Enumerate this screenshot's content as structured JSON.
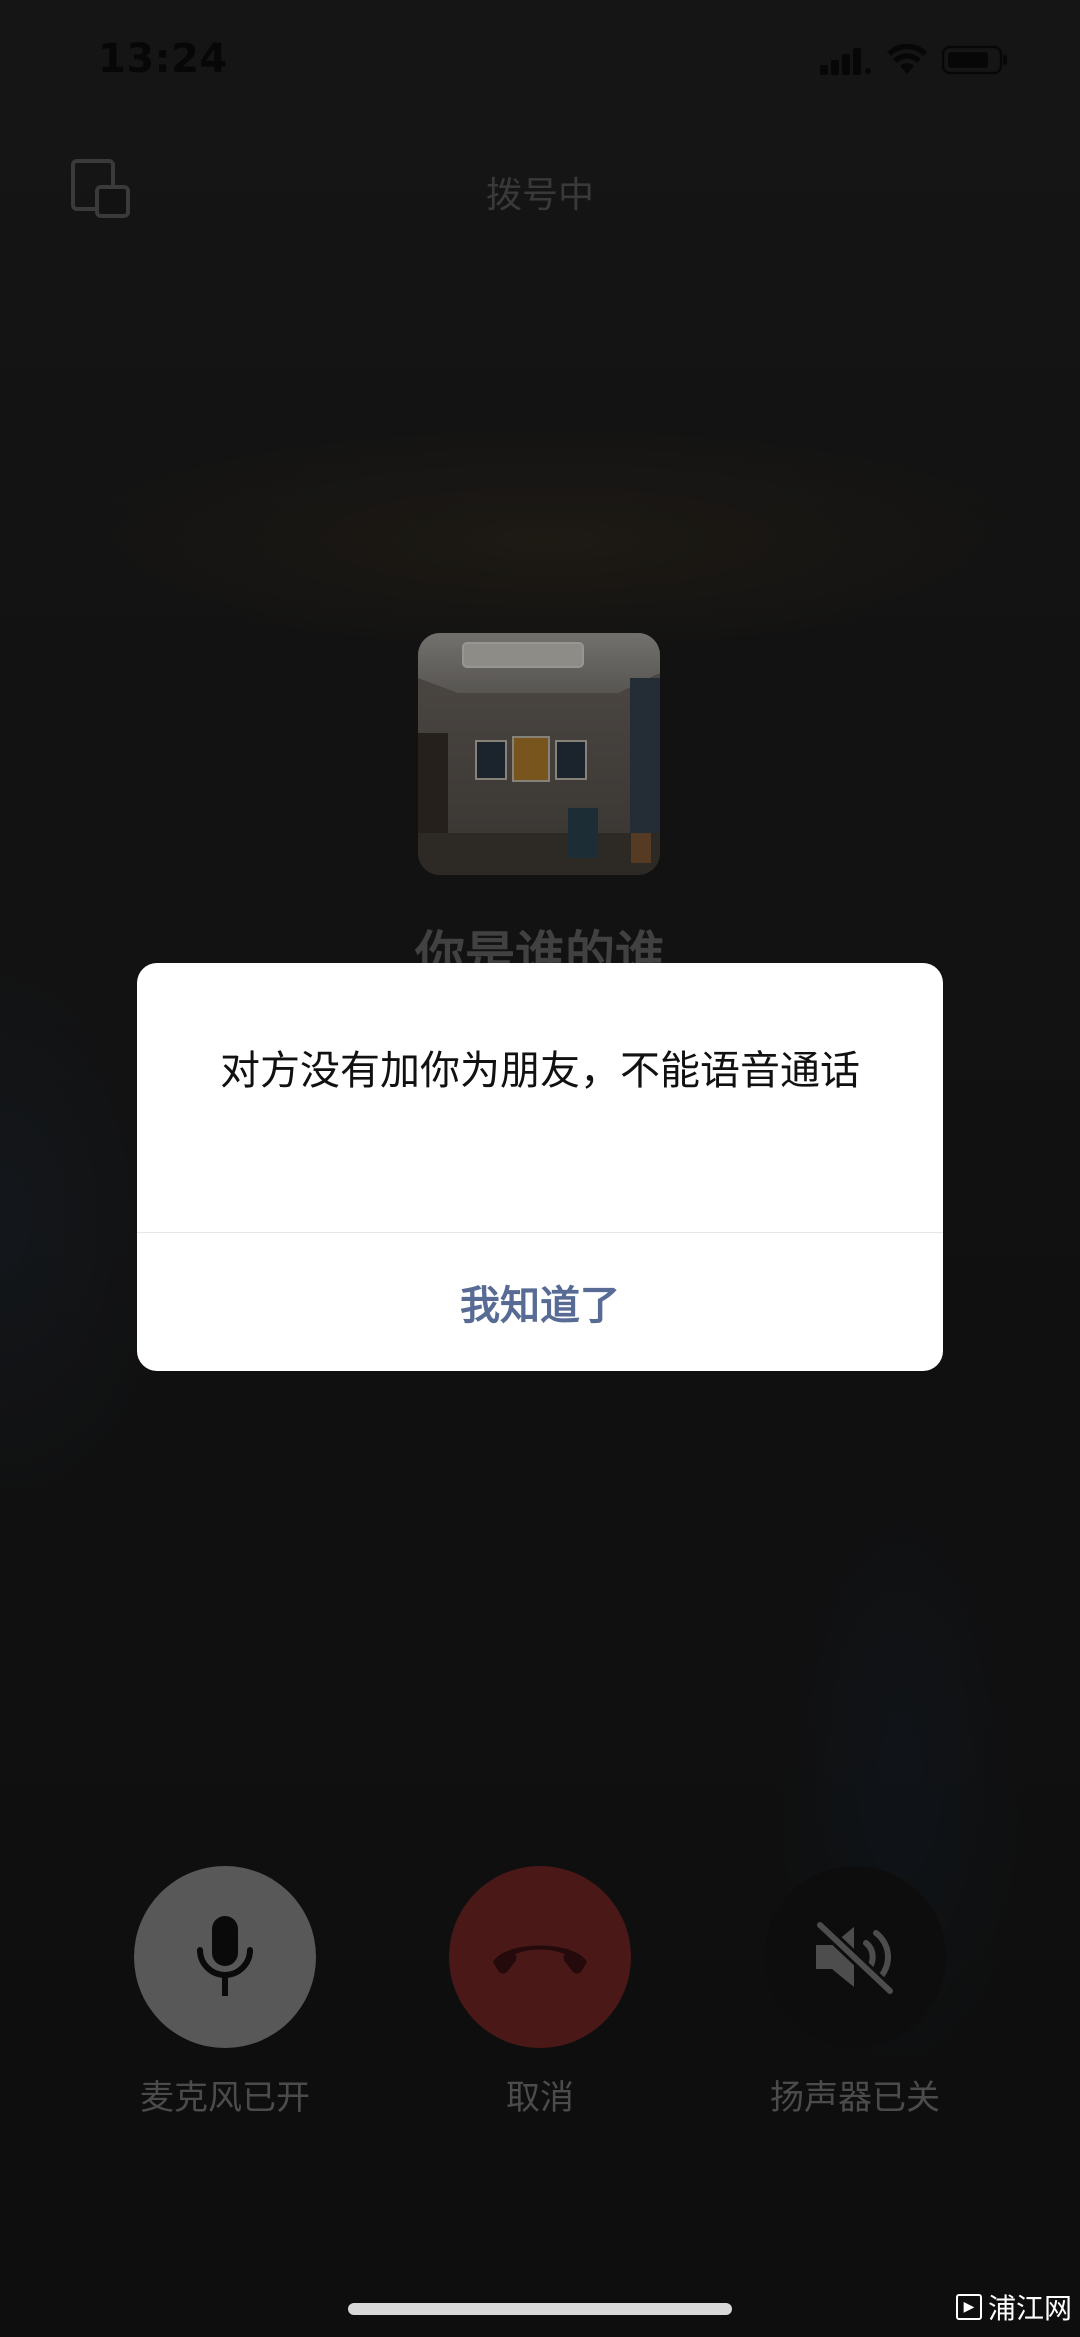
{
  "status_bar": {
    "time": "13:24",
    "icons": [
      "signal-icon",
      "wifi-icon",
      "battery-icon"
    ]
  },
  "call": {
    "status_text": "拨号中",
    "contact_name": "你是谁的谁"
  },
  "controls": {
    "mic": {
      "label": "麦克风已开",
      "icon": "microphone-icon",
      "color": "#8f8f8f"
    },
    "cancel": {
      "label": "取消",
      "icon": "hang-up-icon",
      "color": "#7a2727"
    },
    "speaker": {
      "label": "扬声器已关",
      "icon": "speaker-muted-icon",
      "color": "#161616"
    }
  },
  "dialog": {
    "message": "对方没有加你为朋友，不能语音通话",
    "button_label": "我知道了",
    "button_color": "#576b95"
  },
  "watermark": {
    "text": "浦江网"
  }
}
